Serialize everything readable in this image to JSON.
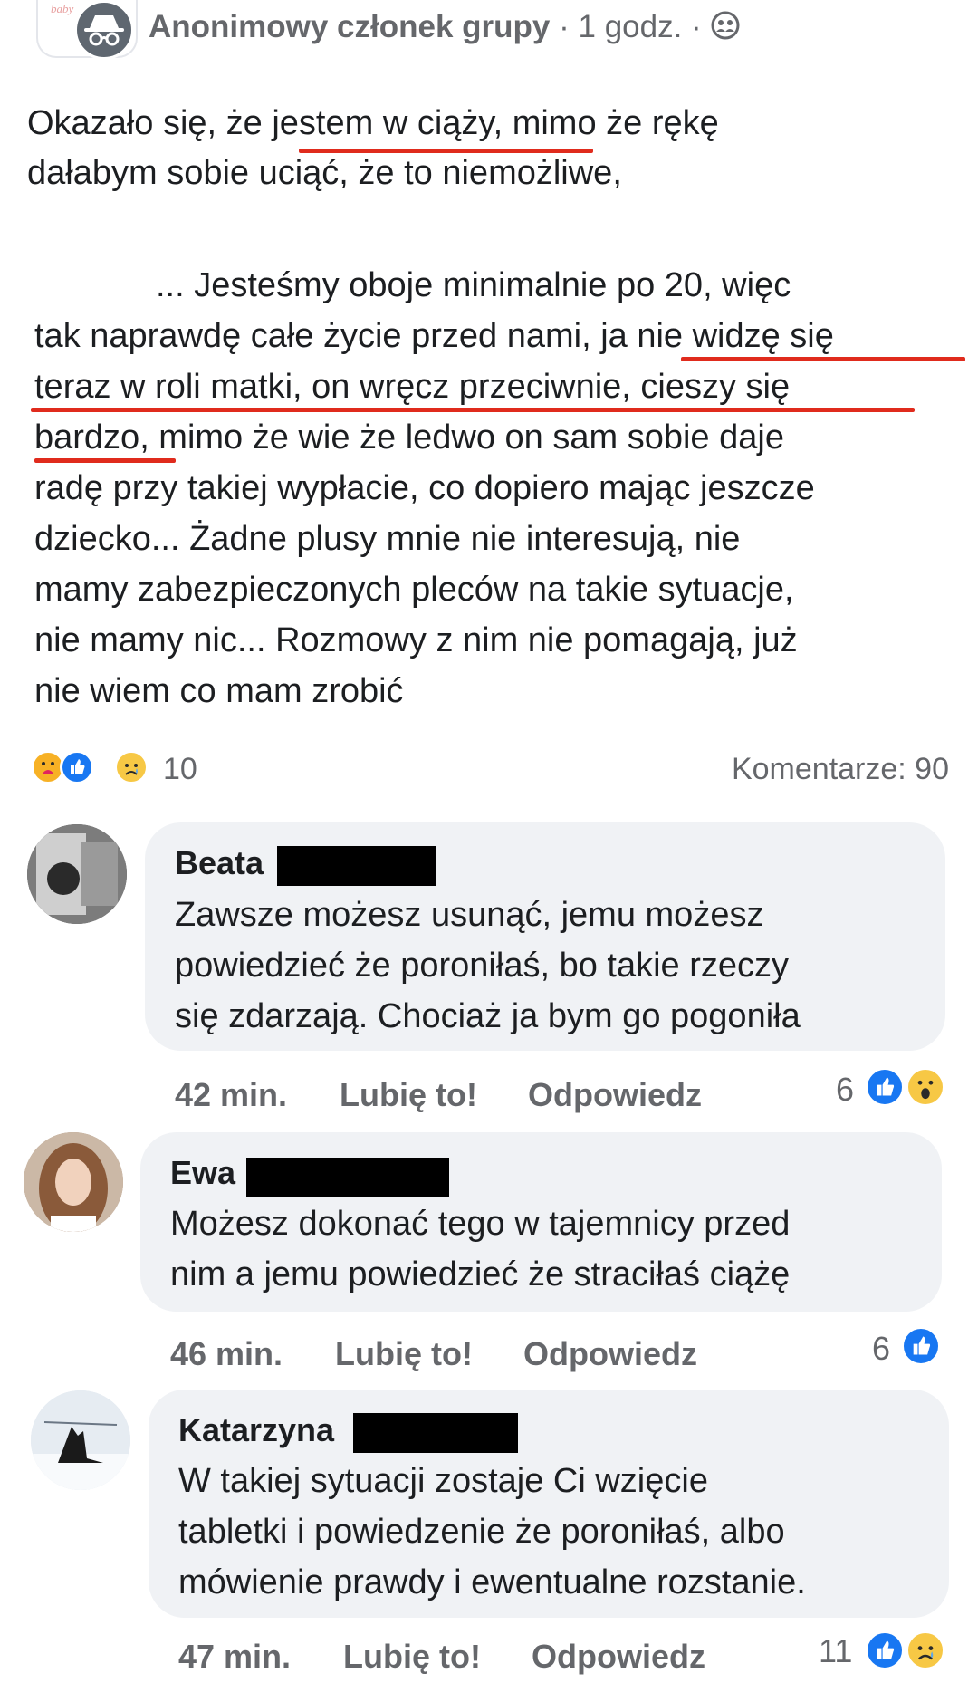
{
  "group": {
    "logo_text": "baby"
  },
  "post": {
    "author": "Anonimowy członek grupy",
    "separator": " · ",
    "time": "1 godz.",
    "lines_top": [
      "Okazało się, że jestem w ciąży, mimo że rękę",
      "dałabym sobie uciąć, że to niemożliwe,"
    ],
    "lines_bottom": [
      "... Jesteśmy oboje minimalnie po 20, więc",
      "tak naprawdę całe życie przed nami, ja nie widzę się",
      "teraz w roli matki, on wręcz przeciwnie, cieszy się",
      "bardzo, mimo że wie że ledwo on sam sobie daje",
      "radę przy takiej wypłacie, co dopiero mając jeszcze",
      "dziecko... Żadne plusy mnie nie interesują, nie",
      "mamy zabezpieczonych pleców na takie sytuacje,",
      "nie mamy nic... Rozmowy z nim nie pomagają, już",
      "nie wiem co mam zrobić"
    ],
    "reactions_count": "10",
    "comments_label": "Komentarze: 90"
  },
  "comments": [
    {
      "name": "Beata",
      "lines": [
        "Zawsze możesz usunąć, jemu możesz",
        "powiedzieć że poroniłaś, bo takie rzeczy",
        "się zdarzają. Chociaż ja bym go pogoniła"
      ],
      "time": "42 min.",
      "like_label": "Lubię to!",
      "reply_label": "Odpowiedz",
      "reaction_count": "6"
    },
    {
      "name": "Ewa",
      "lines": [
        "Możesz dokonać tego w tajemnicy przed",
        "nim a jemu powiedzieć że straciłaś ciążę"
      ],
      "time": "46 min.",
      "like_label": "Lubię to!",
      "reply_label": "Odpowiedz",
      "reaction_count": "6"
    },
    {
      "name": "Katarzyna",
      "lines": [
        "W takiej sytuacji zostaje Ci wzięcie",
        "tabletki i powiedzenie że poroniłaś, albo",
        "mówienie prawdy i ewentualne rozstanie."
      ],
      "time": "47 min.",
      "like_label": "Lubię to!",
      "reply_label": "Odpowiedz",
      "reaction_count": "11"
    }
  ],
  "colors": {
    "underline": "#e02b1d",
    "like_blue": "#1877f2",
    "bubble_bg": "#f0f2f5",
    "muted_text": "#65676b"
  }
}
